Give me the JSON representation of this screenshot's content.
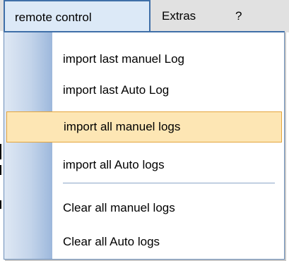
{
  "menubar": {
    "items": [
      {
        "label": "remote control",
        "active": true
      },
      {
        "label": "Extras"
      },
      {
        "label": "?"
      }
    ]
  },
  "dropdown": {
    "items": [
      {
        "label": "import last manuel Log"
      },
      {
        "label": "import last Auto Log"
      },
      {
        "label": "import all manuel logs",
        "highlighted": true
      },
      {
        "label": "import all Auto logs"
      },
      {
        "label": "Clear all manuel logs"
      },
      {
        "label": "Clear all Auto logs"
      }
    ]
  },
  "colors": {
    "menubar_bg": "#e1e1e1",
    "active_menu_bg": "#dce9f7",
    "active_menu_border": "#3f6fa8",
    "highlight_bg": "#fde6b4",
    "highlight_border": "#e4a53b",
    "gutter": "#c3d4ea"
  }
}
